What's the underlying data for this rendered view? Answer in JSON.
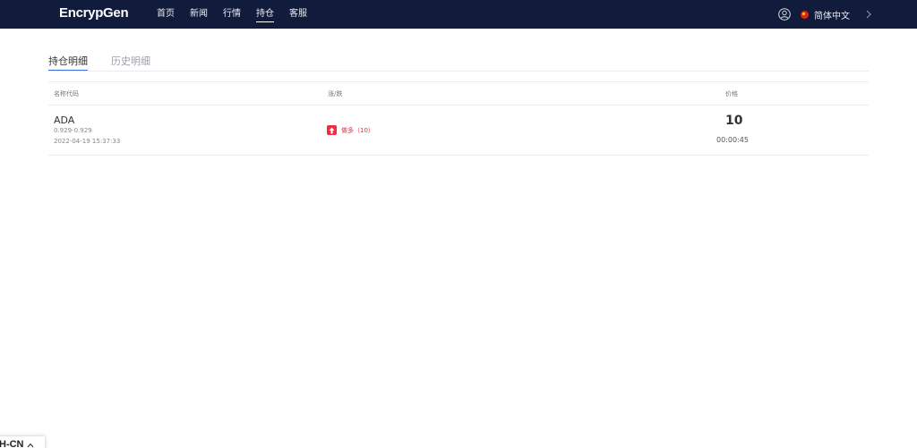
{
  "header": {
    "logo": "EncrypGen",
    "nav": [
      {
        "label": "首页",
        "active": false
      },
      {
        "label": "新闻",
        "active": false
      },
      {
        "label": "行情",
        "active": false
      },
      {
        "label": "持仓",
        "active": true
      },
      {
        "label": "客服",
        "active": false
      }
    ],
    "user_icon": "user-circle-icon",
    "language": "简体中文",
    "language_icon": "china-flag-icon",
    "expand_icon": "chevron-right-icon",
    "background_color": "#111b3b"
  },
  "tabs": [
    {
      "label": "持仓明细",
      "active": true
    },
    {
      "label": "历史明细",
      "active": false
    }
  ],
  "table": {
    "columns": {
      "name": "名称代码",
      "change": "涨/跌",
      "price": "价格"
    },
    "rows": [
      {
        "name": "ADA",
        "range": "0.929-0.929",
        "time": "2022-04-19 15:37:33",
        "direction": "做多（10）",
        "direction_icon": "arrow-up-icon",
        "price": "10",
        "countdown": "00:00:45"
      }
    ]
  },
  "language_widget": {
    "label": "H-CN",
    "icon": "chevron-up-icon"
  },
  "colors": {
    "accent": "#3f6fd8",
    "up": "#ef2d42"
  }
}
